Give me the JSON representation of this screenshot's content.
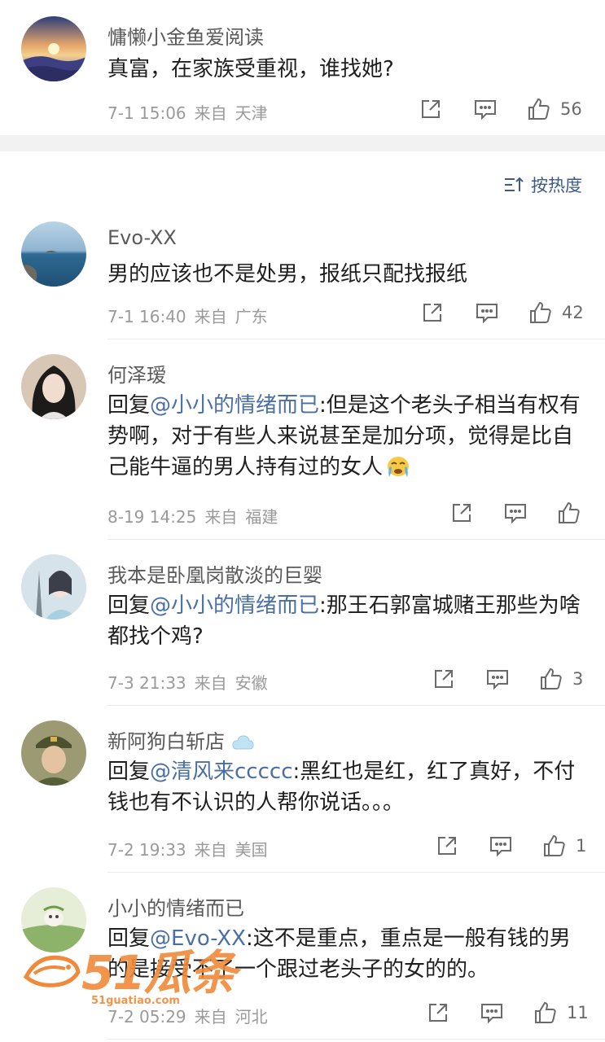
{
  "top_comment": {
    "username": "慵懒小金鱼爱阅读",
    "text": "真富，在家族受重视，谁找她?",
    "time": "7-1 15:06",
    "from": "来自",
    "location": "天津",
    "likes": "56"
  },
  "sort": {
    "label": "按热度"
  },
  "comments": [
    {
      "username": "Evo-XX",
      "text": "男的应该也不是处男，报纸只配找报纸",
      "time": "7-1 16:40",
      "from": "来自",
      "location": "广东",
      "likes": "42"
    },
    {
      "username": "何泽瑷",
      "reply_prefix": "回复",
      "mention": "@小小的情绪而已",
      "text": ":但是这个老头子相当有权有势啊，对于有些人来说甚至是加分项，觉得是比自己能牛逼的男人持有过的女人",
      "emoji": "crying-emoji",
      "time": "8-19 14:25",
      "from": "来自",
      "location": "福建",
      "likes": ""
    },
    {
      "username": "我本是卧凰岗散淡的巨婴",
      "reply_prefix": "回复",
      "mention": "@小小的情绪而已",
      "text": ":那王石郭富城赌王那些为啥都找个鸡?",
      "time": "7-3 21:33",
      "from": "来自",
      "location": "安徽",
      "likes": "3"
    },
    {
      "username": "新阿狗白斩店",
      "reply_prefix": "回复",
      "mention": "@清风来ccccc",
      "text": ":黑红也是红，红了真好，不付钱也有不认识的人帮你说话。。。",
      "time": "7-2 19:33",
      "from": "来自",
      "location": "美国",
      "likes": "1"
    },
    {
      "username": "小小的情绪而已",
      "reply_prefix": "回复",
      "mention": "@Evo-XX",
      "text": ":这不是重点，重点是一般有钱的男的是接受不了一个跟过老头子的女的的。",
      "time": "7-2 05:29",
      "from": "来自",
      "location": "河北",
      "likes": "11"
    }
  ],
  "watermark": {
    "brand": "51瓜条",
    "url": "51guatiao.com"
  },
  "colors": {
    "accent": "#4a6fa5",
    "meta": "#9a9a9a",
    "watermark": "#f08a3a"
  }
}
